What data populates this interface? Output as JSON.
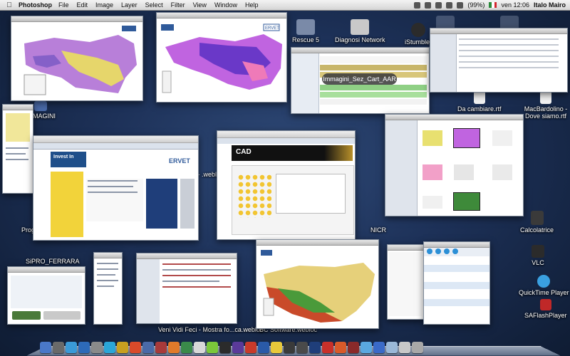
{
  "menubar": {
    "app_name": "Photoshop",
    "menus": [
      "File",
      "Edit",
      "Image",
      "Layer",
      "Select",
      "Filter",
      "View",
      "Window",
      "Help"
    ],
    "battery": "(99%)",
    "clock": "ven 12:06",
    "user": "Italo Mairo"
  },
  "tooltip": "Immagini_Sez_Cart_AAR",
  "desktop_icons": {
    "rescue": "Rescue 5",
    "diagnosi": "Diagnosi Network",
    "istumbler": "iStumbler",
    "immagini": "IMMAGINI",
    "cambiare": "Da cambiare.rtf",
    "macbardolino": "MacBardolino - Dove siamo.rtf",
    "prog": "Prog",
    "sipro": "SiPRO_FERRARA",
    "calcolatrice": "Calcolatrice",
    "vlc": "VLC",
    "quicktime": "QuickTime Player",
    "saflash": "SAFlashPlayer",
    "veni": "Veni Vidi Feci - Mostra fo...ca.webloc",
    "bc": "BC Software.webloc",
    "nicr": "NICR",
    "mac_weblo": "Mac - .webloc"
  },
  "windows": {
    "ervet_label": "ERVET",
    "cad_logo": "CAD",
    "invest": "Invest In"
  },
  "colors": {
    "desktop": "#1d3158",
    "menubar": "#e4e4e4",
    "map_purple": "#b35bd6",
    "map_yellow": "#e8e070"
  }
}
